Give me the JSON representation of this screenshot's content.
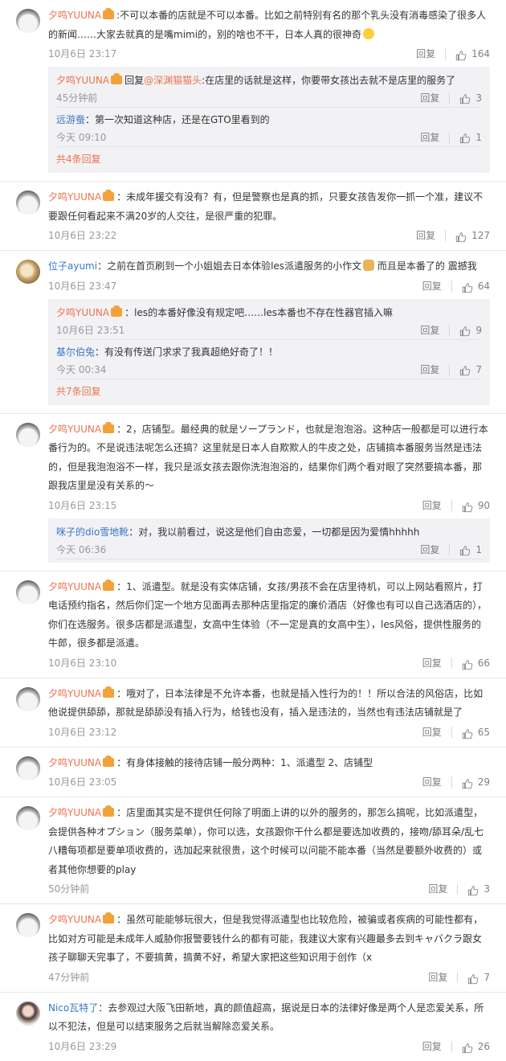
{
  "labels": {
    "reply": "回复",
    "reply_prefix": "回复"
  },
  "comments": [
    {
      "user": "夕鸣YUUNA",
      "avatar": "yuuna",
      "text": ":不可以本番的店就是不可以本番。比如之前特别有名的那个乳头没有消毒感染了很多人的新闻……大家去就真的是嘴mimi的，别的啥也不干，日本人真的很神奇",
      "emoji": "smile",
      "time": "10月6日 23:17",
      "likes": "164",
      "replies": [
        {
          "user": "夕鸣YUUNA",
          "mention": "@深渊猫猫头",
          "text": ":在店里的话就是这样，你要带女孩出去就不是店里的服务了",
          "time": "45分钟前",
          "likes": "3"
        },
        {
          "user": "远游蚕",
          "text": "：第一次知道这种店，还是在GTO里看到的",
          "time": "今天 09:10",
          "likes": "1"
        }
      ],
      "more": "共4条回复"
    },
    {
      "user": "夕鸣YUUNA",
      "avatar": "yuuna",
      "text": "：未成年援交有没有？有，但是警察也是真的抓，只要女孩告发你一抓一个准，建议不要跟任何看起来不满20岁的人交往，是很严重的犯罪。",
      "time": "10月6日 23:22",
      "likes": "127"
    },
    {
      "user": "位子ayumi",
      "avatar": "cat",
      "text": "：之前在首页刷到一个小姐姐去日本体验les派遣服务的小作文",
      "emoji": "person",
      "text_after": "而且是本番了的 震撼我",
      "time": "10月6日 23:47",
      "likes": "64",
      "replies": [
        {
          "user": "夕鸣YUUNA",
          "text": "：les的本番好像没有规定吧……les本番也不存在性器官插入嘛",
          "time": "10月6日 23:51",
          "likes": "9"
        },
        {
          "user": "基尔伯兔",
          "text": "：有没有传送门求求了我真超绝好奇了！！",
          "time": "今天 00:34",
          "likes": "7"
        }
      ],
      "more": "共7条回复"
    },
    {
      "user": "夕鸣YUUNA",
      "avatar": "yuuna",
      "text": "：2，店铺型。最经典的就是ソープランド，也就是泡泡浴。这种店一般都是可以进行本番行为的。不是说违法呢怎么还搞？这里就是日本人自欺欺人的牛皮之处，店铺搞本番服务当然是违法的，但是我泡泡浴不一样，我只是派女孩去跟你洗泡泡浴的，结果你们两个看对眼了突然要搞本番，那跟我店里是没有关系的～",
      "time": "10月6日 23:15",
      "likes": "90",
      "replies": [
        {
          "user": "咪子的dio雪地靴",
          "text": "：对，我以前看过，说这是他们自由恋爱，一切都是因为爱情hhhhh",
          "time": "今天 06:36",
          "likes": "1"
        }
      ]
    },
    {
      "user": "夕鸣YUUNA",
      "avatar": "yuuna",
      "text": "：1、派遣型。就是没有实体店铺，女孩/男孩不会在店里待机，可以上网站看照片，打电话预约指名，然后你们定一个地方见面再去那种店里指定的廉价酒店（好像也有可以自己选酒店的），你们在选服务。很多店都是派遣型，女高中生体验（不一定是真的女高中生），les风俗，提供性服务的牛郎，很多都是派遣。",
      "time": "10月6日 23:10",
      "likes": "66"
    },
    {
      "user": "夕鸣YUUNA",
      "avatar": "yuuna",
      "text": "：哦对了，日本法律是不允许本番，也就是插入性行为的！！所以合法的风俗店，比如他说提供舔舔，那就是舔舔没有插入行为，给钱也没有，插入是违法的，当然也有违法店铺就是了",
      "time": "10月6日 23:12",
      "likes": "65"
    },
    {
      "user": "夕鸣YUUNA",
      "avatar": "yuuna",
      "text": "：有身体接触的接待店铺一般分两种：1、派遣型 2、店铺型",
      "time": "10月6日 23:05",
      "likes": "29"
    },
    {
      "user": "夕鸣YUUNA",
      "avatar": "yuuna",
      "text": "：店里面其实是不提供任何除了明面上讲的以外的服务的，那怎么搞呢，比如派遣型，会提供各种オプション（服务菜单），你可以选，女孩跟你干什么都是要选加收费的，接吻/舔耳朵/乱七八糟每项都是要单项收费的，选加起来就很贵，这个时候可以问能不能本番（当然是要额外收费的）或者其他你想要的play",
      "time": "50分钟前",
      "likes": "3"
    },
    {
      "user": "夕鸣YUUNA",
      "avatar": "yuuna",
      "text": "：虽然可能能够玩很大，但是我觉得派遣型也比较危险，被骗或者疾病的可能性都有，比如对方可能是未成年人威胁你报警要钱什么的都有可能，我建议大家有兴趣最多去到キャバクラ跟女孩子聊聊天完事了，不要搞黄，搞黄不好，希望大家把这些知识用于创作（x",
      "time": "47分钟前",
      "likes": "7"
    },
    {
      "user": "Nico瓦特了",
      "avatar": "nico",
      "text": "：去参观过大阪飞田新地，真的颜值超高，据说是日本的法律好像是两个人是恋爱关系，所以不犯法，但是可以结束服务之后就当解除恋爱关系。",
      "time": "10月6日 23:29",
      "likes": "26"
    }
  ]
}
